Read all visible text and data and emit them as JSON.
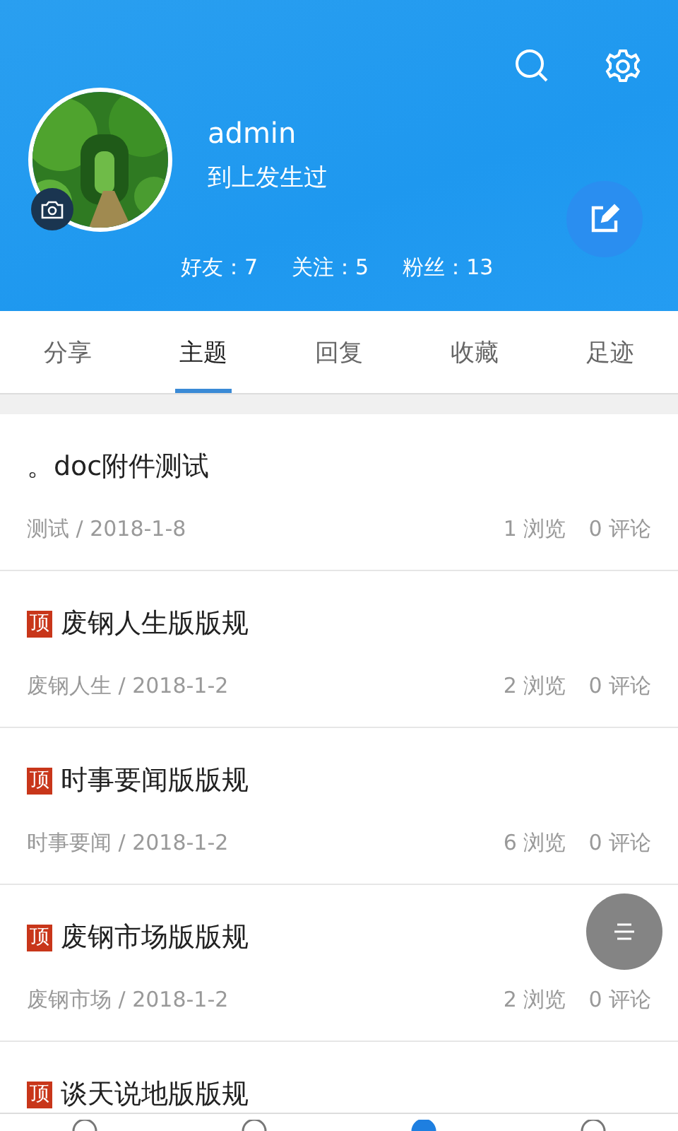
{
  "profile": {
    "username": "admin",
    "signature": "到上发生过",
    "stats": [
      "好友：7",
      "关注：5",
      "粉丝：13"
    ]
  },
  "tabs": [
    {
      "label": "分享",
      "selected": false
    },
    {
      "label": "主题",
      "selected": true
    },
    {
      "label": "回复",
      "selected": false
    },
    {
      "label": "收藏",
      "selected": false
    },
    {
      "label": "足迹",
      "selected": false
    }
  ],
  "topics": [
    {
      "pinned": false,
      "title": "。doc附件测试",
      "meta": "测试 / 2018-1-8",
      "views": "1 浏览",
      "comments": "0 评论"
    },
    {
      "pinned": true,
      "badge": "顶",
      "title": "废钢人生版版规",
      "meta": "废钢人生 / 2018-1-2",
      "views": "2 浏览",
      "comments": "0 评论"
    },
    {
      "pinned": true,
      "badge": "顶",
      "title": "时事要闻版版规",
      "meta": "时事要闻 / 2018-1-2",
      "views": "6 浏览",
      "comments": "0 评论"
    },
    {
      "pinned": true,
      "badge": "顶",
      "title": "废钢市场版版规",
      "meta": "废钢市场 / 2018-1-2",
      "views": "2 浏览",
      "comments": "0 评论"
    },
    {
      "pinned": true,
      "badge": "顶",
      "title": "谈天说地版版规"
    }
  ],
  "bottom_nav": [
    {
      "selected": false
    },
    {
      "selected": false
    },
    {
      "selected": true
    },
    {
      "selected": false
    }
  ]
}
